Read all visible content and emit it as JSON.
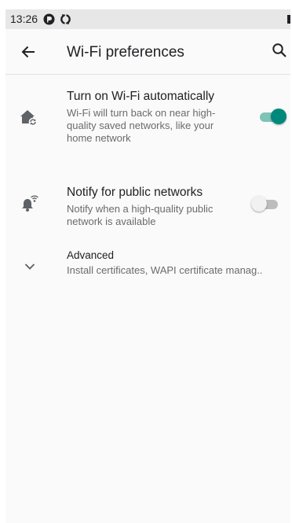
{
  "status_bar": {
    "time": "13:26",
    "icons": [
      "data-saver-icon",
      "sync-icon",
      "battery-icon"
    ]
  },
  "app_bar": {
    "title": "Wi-Fi preferences",
    "back_icon": "back-arrow-icon",
    "search_icon": "search-icon"
  },
  "preferences": [
    {
      "title": "Turn on Wi-Fi automatically",
      "summary": "Wi-Fi will turn back on near high-quality saved networks, like your home network",
      "icon": "wifi-auto-home-icon",
      "switch_on": true
    },
    {
      "title": "Notify for public networks",
      "summary": "Notify when a high-quality public network is available",
      "icon": "wifi-notification-bell-icon",
      "switch_on": false
    },
    {
      "title": "Advanced",
      "summary": "Install certificates, WAPI certificate manag..",
      "icon": "chevron-down-icon"
    }
  ],
  "colors": {
    "accent": "#00897b",
    "accent_track": "#7fc2b8",
    "status_bar_bg": "#e7e7e7",
    "screen_bg": "#fafafa"
  }
}
